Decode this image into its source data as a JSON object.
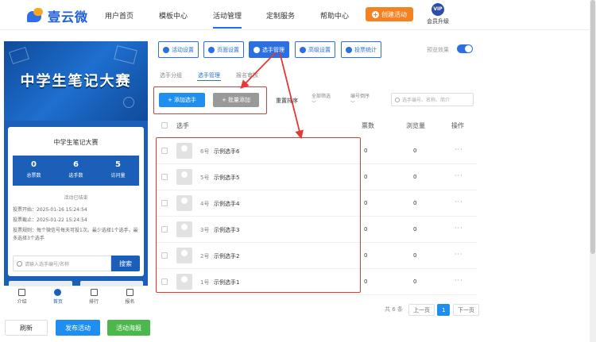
{
  "brand": {
    "name": "壹云微"
  },
  "nav": {
    "items": [
      "用户首页",
      "模板中心",
      "活动管理",
      "定制服务",
      "帮助中心"
    ],
    "create_label": "创建活动",
    "vip_badge": "VIP",
    "vip_label": "会员升级"
  },
  "preview": {
    "banner_title": "中学生笔记大赛",
    "card_title": "中学生笔记大赛",
    "stats": [
      {
        "value": "0",
        "label": "总票数"
      },
      {
        "value": "6",
        "label": "选手数"
      },
      {
        "value": "5",
        "label": "访问量"
      }
    ],
    "status": "活动已结束",
    "vote_start": "投票开始：2025-01-16 15:24:54",
    "vote_end": "投票截止：2025-01-22 15:24:54",
    "vote_rule": "投票规则：每个微信号每天可投1次。最少选择1个选手，最多选择3个选手",
    "search_placeholder": "请输入选手编号/名称",
    "search_button": "搜索",
    "tabs": [
      "介绍",
      "首页",
      "排行",
      "报名"
    ]
  },
  "actions": {
    "refresh": "刷新",
    "publish": "发布活动",
    "poster": "活动海报"
  },
  "tools": {
    "items": [
      "活动设置",
      "页面设置",
      "选手管理",
      "高级设置",
      "投票统计"
    ],
    "preview_effect": "预览效果"
  },
  "subtabs": [
    "选手分组",
    "选手管理",
    "报名审核"
  ],
  "toolbar": {
    "add": "+ 添加选手",
    "batch": "+ 批量添加",
    "reset": "重置排序",
    "filter_all": "全部筛选",
    "filter_num": "编号倒序",
    "search_placeholder": "选手编号、名称、简介"
  },
  "table": {
    "headers": [
      "选手",
      "票数",
      "浏览量",
      "操作"
    ],
    "rows": [
      {
        "no": "6号",
        "name": "示例选手6",
        "votes": "0",
        "views": "0",
        "op": "···"
      },
      {
        "no": "5号",
        "name": "示例选手5",
        "votes": "0",
        "views": "0",
        "op": "···"
      },
      {
        "no": "4号",
        "name": "示例选手4",
        "votes": "0",
        "views": "0",
        "op": "···"
      },
      {
        "no": "3号",
        "name": "示例选手3",
        "votes": "0",
        "views": "0",
        "op": "···"
      },
      {
        "no": "2号",
        "name": "示例选手2",
        "votes": "0",
        "views": "0",
        "op": "···"
      },
      {
        "no": "1号",
        "name": "示例选手1",
        "votes": "0",
        "views": "0",
        "op": "···"
      }
    ]
  },
  "pagination": {
    "total": "共 6 条",
    "prev": "上一页",
    "current": "1",
    "next": "下一页"
  },
  "colors": {
    "primary": "#1e8ff0",
    "accent_orange": "#f58220",
    "highlight_red": "#e53935",
    "preview_blue": "#1b5fb8"
  }
}
